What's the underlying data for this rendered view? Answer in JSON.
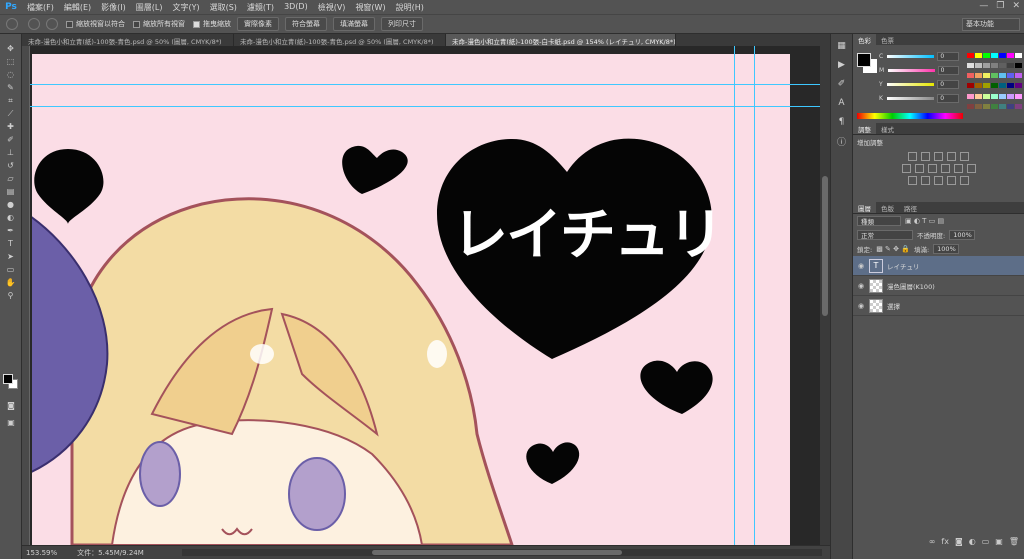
{
  "app": {
    "logo": "Ps"
  },
  "menu": [
    "檔案(F)",
    "編輯(E)",
    "影像(I)",
    "圖層(L)",
    "文字(Y)",
    "選取(S)",
    "濾鏡(T)",
    "3D(D)",
    "檢視(V)",
    "視窗(W)",
    "說明(H)"
  ],
  "window_controls": [
    "—",
    "❐",
    "✕"
  ],
  "options_bar": {
    "checks": [
      {
        "label": "縮放視窗以符合",
        "checked": false
      },
      {
        "label": "縮放所有視窗",
        "checked": false
      },
      {
        "label": "拖曳縮放",
        "checked": true
      }
    ],
    "buttons": [
      "實際像素",
      "符合螢幕",
      "填滿螢幕",
      "列印尺寸"
    ],
    "workspace": "基本功能"
  },
  "doc_tabs": [
    {
      "label": "未命-漫色小和立青(紙)-100張-青色.psd @ 50% (圖層, CMYK/8*)",
      "active": false
    },
    {
      "label": "未命-漫色小和立青(紙)-100張-青色.psd @ 50% (圖層, CMYK/8*)",
      "active": false
    },
    {
      "label": "未命-漫色小和立青(紙)-100張-白卡紙.psd @ 154% (レイチュリ, CMYK/8*) *",
      "active": true
    }
  ],
  "artwork": {
    "heart_text": "レイチュリ"
  },
  "status": {
    "zoom": "153.59%",
    "doc_info": "文件：5.45M/9.24M"
  },
  "color_panel": {
    "tabs": [
      "色彩",
      "色票"
    ],
    "sliders": [
      {
        "label": "C",
        "value": "0",
        "color": "#00bfff"
      },
      {
        "label": "M",
        "value": "0",
        "color": "#ff33aa"
      },
      {
        "label": "Y",
        "value": "0",
        "color": "#e6e600"
      },
      {
        "label": "K",
        "value": "0",
        "color": "#888888"
      }
    ]
  },
  "adjust_panel": {
    "tabs": [
      "調整",
      "樣式"
    ],
    "title": "增加調整"
  },
  "layers_panel": {
    "tabs": [
      "圖層",
      "色版",
      "路徑"
    ],
    "kind": "種類",
    "blend": "正常",
    "opacity_label": "不透明度:",
    "opacity": "100%",
    "lock_label": "鎖定:",
    "fill_label": "填滿:",
    "fill": "100%",
    "layers": [
      {
        "name": "レイチュリ",
        "type": "text",
        "selected": true
      },
      {
        "name": "漫色圖層(K100)",
        "type": "pixel",
        "selected": false
      },
      {
        "name": "選擇",
        "type": "pixel",
        "selected": false
      }
    ]
  }
}
